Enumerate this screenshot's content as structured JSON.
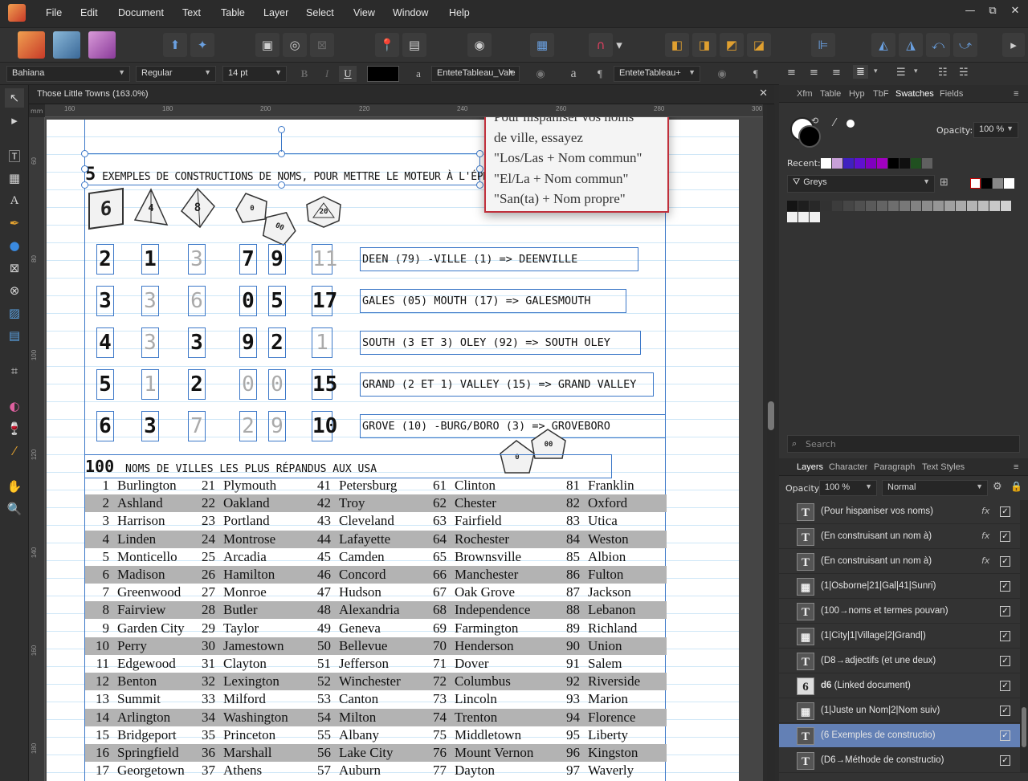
{
  "menu": [
    "File",
    "Edit",
    "Document",
    "Text",
    "Table",
    "Layer",
    "Select",
    "View",
    "Window",
    "Help"
  ],
  "window_controls": [
    "—",
    "⧉",
    "✕"
  ],
  "context_bar": {
    "font_family": "Bahiana",
    "font_style": "Regular",
    "font_size": "14 pt",
    "char_style": "EnteteTableau_Vale",
    "para_style": "EnteteTableau+",
    "bold": "B",
    "italic": "I",
    "underline": "U",
    "a1": "a",
    "a2": "a",
    "pilcrow": "¶"
  },
  "document": {
    "tab_title": "Those Little Towns (163.0%)",
    "units": "mm",
    "hruler_labels": [
      "160",
      "180",
      "200",
      "220",
      "240",
      "260",
      "280",
      "300"
    ],
    "vruler_labels": [
      "60",
      "80",
      "100",
      "120",
      "140",
      "160",
      "180"
    ]
  },
  "page": {
    "heading_dice_num": "5",
    "heading_dice": "exemples de constructions de noms, pour mettre le moteur à l'épreuve",
    "note_lines": [
      "Pour hispaniser vos noms",
      "de ville, essayez",
      "\"Los/Las + Nom commun\"",
      "\"El/La + Nom commun\"",
      "\"San(ta) + Nom propre\""
    ],
    "dice_labels": [
      "6",
      "4",
      "8",
      "0",
      "00",
      "20"
    ],
    "dice_rows": [
      {
        "nums": [
          "2",
          "1",
          "3",
          "7",
          "9",
          "11"
        ],
        "grey": [
          false,
          false,
          true,
          false,
          false,
          true
        ],
        "example": "Deen (79) -ville (1) => Deenville"
      },
      {
        "nums": [
          "3",
          "3",
          "6",
          "0",
          "5",
          "17"
        ],
        "grey": [
          false,
          true,
          true,
          false,
          false,
          false
        ],
        "example": "Gales (05) Mouth (17) => Galesmouth"
      },
      {
        "nums": [
          "4",
          "3",
          "3",
          "9",
          "2",
          "1"
        ],
        "grey": [
          false,
          true,
          false,
          false,
          false,
          true
        ],
        "example": "South (3 et 3) Oley (92) => South Oley"
      },
      {
        "nums": [
          "5",
          "1",
          "2",
          "0",
          "0",
          "15"
        ],
        "grey": [
          false,
          true,
          false,
          true,
          true,
          false
        ],
        "example": "Grand (2 et 1) Valley (15) => Grand Valley"
      },
      {
        "nums": [
          "6",
          "3",
          "7",
          "2",
          "9",
          "10"
        ],
        "grey": [
          false,
          false,
          true,
          true,
          true,
          false
        ],
        "example": "Grove (10) -burg/boro (3) => Groveboro"
      }
    ],
    "heading_towns_num": "100",
    "heading_towns": "noms de villes les plus répandus aux USA",
    "towns": [
      [
        [
          "1",
          "Burlington"
        ],
        [
          "21",
          "Plymouth"
        ],
        [
          "41",
          "Petersburg"
        ],
        [
          "61",
          "Clinton"
        ],
        [
          "81",
          "Franklin"
        ]
      ],
      [
        [
          "2",
          "Ashland"
        ],
        [
          "22",
          "Oakland"
        ],
        [
          "42",
          "Troy"
        ],
        [
          "62",
          "Chester"
        ],
        [
          "82",
          "Oxford"
        ]
      ],
      [
        [
          "3",
          "Harrison"
        ],
        [
          "23",
          "Portland"
        ],
        [
          "43",
          "Cleveland"
        ],
        [
          "63",
          "Fairfield"
        ],
        [
          "83",
          "Utica"
        ]
      ],
      [
        [
          "4",
          "Linden"
        ],
        [
          "24",
          "Montrose"
        ],
        [
          "44",
          "Lafayette"
        ],
        [
          "64",
          "Rochester"
        ],
        [
          "84",
          "Weston"
        ]
      ],
      [
        [
          "5",
          "Monticello"
        ],
        [
          "25",
          "Arcadia"
        ],
        [
          "45",
          "Camden"
        ],
        [
          "65",
          "Brownsville"
        ],
        [
          "85",
          "Albion"
        ]
      ],
      [
        [
          "6",
          "Madison"
        ],
        [
          "26",
          "Hamilton"
        ],
        [
          "46",
          "Concord"
        ],
        [
          "66",
          "Manchester"
        ],
        [
          "86",
          "Fulton"
        ]
      ],
      [
        [
          "7",
          "Greenwood"
        ],
        [
          "27",
          "Monroe"
        ],
        [
          "47",
          "Hudson"
        ],
        [
          "67",
          "Oak Grove"
        ],
        [
          "87",
          "Jackson"
        ]
      ],
      [
        [
          "8",
          "Fairview"
        ],
        [
          "28",
          "Butler"
        ],
        [
          "48",
          "Alexandria"
        ],
        [
          "68",
          "Independence"
        ],
        [
          "88",
          "Lebanon"
        ]
      ],
      [
        [
          "9",
          "Garden City"
        ],
        [
          "29",
          "Taylor"
        ],
        [
          "49",
          "Geneva"
        ],
        [
          "69",
          "Farmington"
        ],
        [
          "89",
          "Richland"
        ]
      ],
      [
        [
          "10",
          "Perry"
        ],
        [
          "30",
          "Jamestown"
        ],
        [
          "50",
          "Bellevue"
        ],
        [
          "70",
          "Henderson"
        ],
        [
          "90",
          "Union"
        ]
      ],
      [
        [
          "11",
          "Edgewood"
        ],
        [
          "31",
          "Clayton"
        ],
        [
          "51",
          "Jefferson"
        ],
        [
          "71",
          "Dover"
        ],
        [
          "91",
          "Salem"
        ]
      ],
      [
        [
          "12",
          "Benton"
        ],
        [
          "32",
          "Lexington"
        ],
        [
          "52",
          "Winchester"
        ],
        [
          "72",
          "Columbus"
        ],
        [
          "92",
          "Riverside"
        ]
      ],
      [
        [
          "13",
          "Summit"
        ],
        [
          "33",
          "Milford"
        ],
        [
          "53",
          "Canton"
        ],
        [
          "73",
          "Lincoln"
        ],
        [
          "93",
          "Marion"
        ]
      ],
      [
        [
          "14",
          "Arlington"
        ],
        [
          "34",
          "Washington"
        ],
        [
          "54",
          "Milton"
        ],
        [
          "74",
          "Trenton"
        ],
        [
          "94",
          "Florence"
        ]
      ],
      [
        [
          "15",
          "Bridgeport"
        ],
        [
          "35",
          "Princeton"
        ],
        [
          "55",
          "Albany"
        ],
        [
          "75",
          "Middletown"
        ],
        [
          "95",
          "Liberty"
        ]
      ],
      [
        [
          "16",
          "Springfield"
        ],
        [
          "36",
          "Marshall"
        ],
        [
          "56",
          "Lake City"
        ],
        [
          "76",
          "Mount Vernon"
        ],
        [
          "96",
          "Kingston"
        ]
      ],
      [
        [
          "17",
          "Georgetown"
        ],
        [
          "37",
          "Athens"
        ],
        [
          "57",
          "Auburn"
        ],
        [
          "77",
          "Dayton"
        ],
        [
          "97",
          "Waverly"
        ]
      ]
    ]
  },
  "right_panel": {
    "top_tabs": [
      "Xfm",
      "Table",
      "Hyp",
      "TbF",
      "Swatches",
      "Fields"
    ],
    "active_top_tab": "Swatches",
    "opacity_label": "Opacity:",
    "opacity_value": "100 %",
    "recent_label": "Recent:",
    "recent_colors": [
      "#ffffff",
      "#c8a0d8",
      "#4020c0",
      "#6010d0",
      "#8000c0",
      "#a000c0",
      "#000000",
      "#101010",
      "#205020",
      "#606060"
    ],
    "palette_name": "Greys",
    "search_placeholder": "Search",
    "layer_tabs": [
      "Layers",
      "Character",
      "Paragraph",
      "Text Styles"
    ],
    "active_layer_tab": "Layers",
    "layers_opacity_label": "Opacity:",
    "layers_opacity": "100 %",
    "blend_mode": "Normal",
    "layers": [
      {
        "icon": "T",
        "name": "(Pour hispaniser vos noms)",
        "fx": true,
        "selected": false
      },
      {
        "icon": "T",
        "name": "(En construisant un nom à)",
        "fx": true,
        "selected": false
      },
      {
        "icon": "T",
        "name": "(En construisant un nom à)",
        "fx": true,
        "selected": false
      },
      {
        "icon": "▦",
        "name": "(1|Osborne|21|Gal|41|Sunri)",
        "fx": false,
        "selected": false
      },
      {
        "icon": "T",
        "name": "(100→noms et termes pouvan)",
        "fx": false,
        "selected": false
      },
      {
        "icon": "▦",
        "name": "(1|City|1|Village|2|Grand|)",
        "fx": false,
        "selected": false
      },
      {
        "icon": "T",
        "name": "(D8→adjectifs (et une deux)",
        "fx": false,
        "selected": false
      },
      {
        "icon": "6",
        "name": "d6",
        "suffix": " (Linked document)",
        "fx": false,
        "selected": false
      },
      {
        "icon": "▦",
        "name": "(1|Juste un Nom|2|Nom suiv)",
        "fx": false,
        "selected": false
      },
      {
        "icon": "T",
        "name": "(6 Exemples de constructio)",
        "fx": false,
        "selected": true
      },
      {
        "icon": "T",
        "name": "(D6→Méthode de constructio)",
        "fx": false,
        "selected": false
      }
    ],
    "check_mark": "✓",
    "fx_label": "fx"
  },
  "colors": {
    "accent_red": "#c0303c",
    "selection_blue": "#3c78c8",
    "layer_selected": "#6380b5"
  }
}
